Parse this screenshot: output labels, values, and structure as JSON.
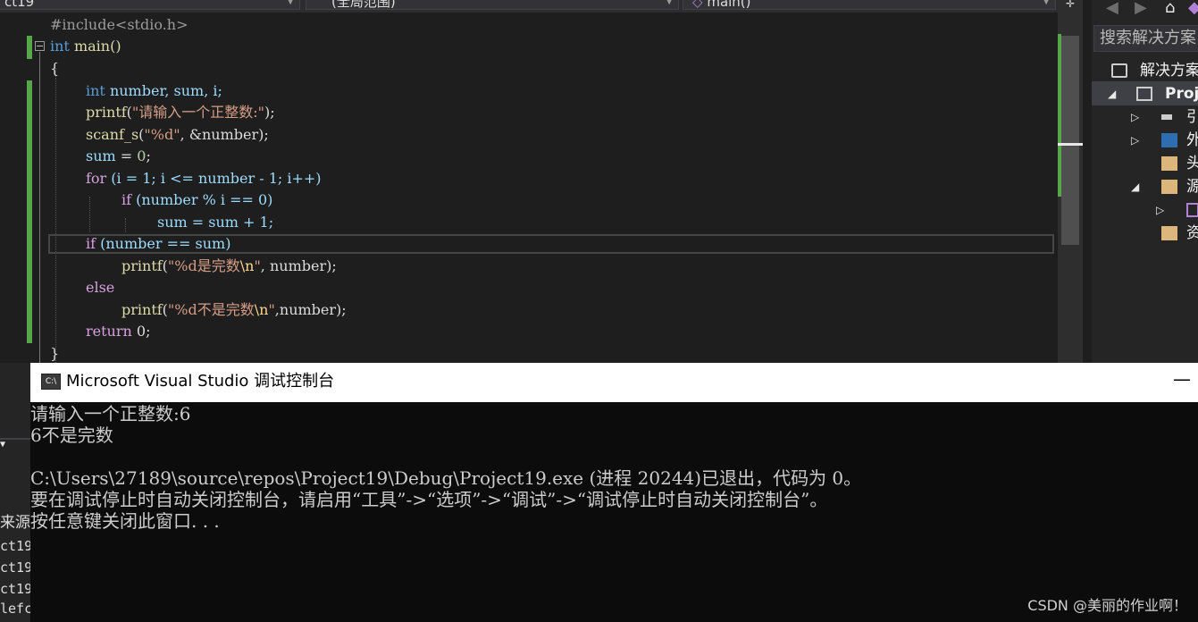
{
  "navbar": {
    "project_dropdown": "ct19",
    "scope_dropdown": "(全局范围)",
    "member_dropdown": "main()"
  },
  "code": {
    "line1": "#include<stdio.h>",
    "line2_kw": "int",
    "line2_fn": " main()",
    "line3": "{",
    "line4_kw": "int",
    "line4_rest": " number, sum, i;",
    "line5_fn": "printf",
    "line5_str": "\"请输入一个正整数:\"",
    "line5_end": ");",
    "line6_fn": "scanf_s",
    "line6_str": "\"%d\"",
    "line6_end": ", &number);",
    "line7_var": "sum",
    "line7_rest": " = ",
    "line7_num": "0",
    "line7_end": ";",
    "line8_kw": "for",
    "line8_rest": " (i = 1; i <= number - 1; i++)",
    "line9_kw": "if",
    "line9_rest": " (number % i == 0)",
    "line10": "sum = sum + 1;",
    "line11_kw": "if",
    "line11_rest": " (number == sum)",
    "line12_fn": "printf",
    "line12_str": "\"%d是完数",
    "line12_esc": "\\n",
    "line12_str2": "\"",
    "line12_end": ", number);",
    "line13_kw": "else",
    "line14_fn": "printf",
    "line14_str": "\"%d不是完数",
    "line14_esc": "\\n",
    "line14_str2": "\"",
    "line14_end": ",number);",
    "line15_kw": "return",
    "line15_rest": " 0;",
    "line16": "}"
  },
  "solution_explorer": {
    "search_placeholder": "搜索解决方案",
    "solution_label": "解决方案",
    "project_label": "Proj",
    "items": [
      "引",
      "外",
      "头",
      "源",
      "",
      "资"
    ]
  },
  "left_pane": {
    "source_label": "来源",
    "lines": [
      "ct19",
      "ct19",
      "ct19",
      "lefc"
    ]
  },
  "console": {
    "title": "Microsoft Visual Studio 调试控制台",
    "icon_text": "C:\\",
    "lines": [
      "请输入一个正整数:6",
      "6不是完数",
      "",
      "C:\\Users\\27189\\source\\repos\\Project19\\Debug\\Project19.exe (进程 20244)已退出，代码为 0。",
      "要在调试停止时自动关闭控制台，请启用“工具”->“选项”->“调试”->“调试停止时自动关闭控制台”。",
      "按任意键关闭此窗口. . ."
    ]
  },
  "watermark": "CSDN @美丽的作业啊！",
  "colors": {
    "keyword": "#569cd6",
    "control_keyword": "#d8a0df",
    "function": "#dcdcaa",
    "variable": "#9cdcfe",
    "string": "#d69d85",
    "number": "#b5cea8",
    "change_bar": "#57a64a"
  }
}
